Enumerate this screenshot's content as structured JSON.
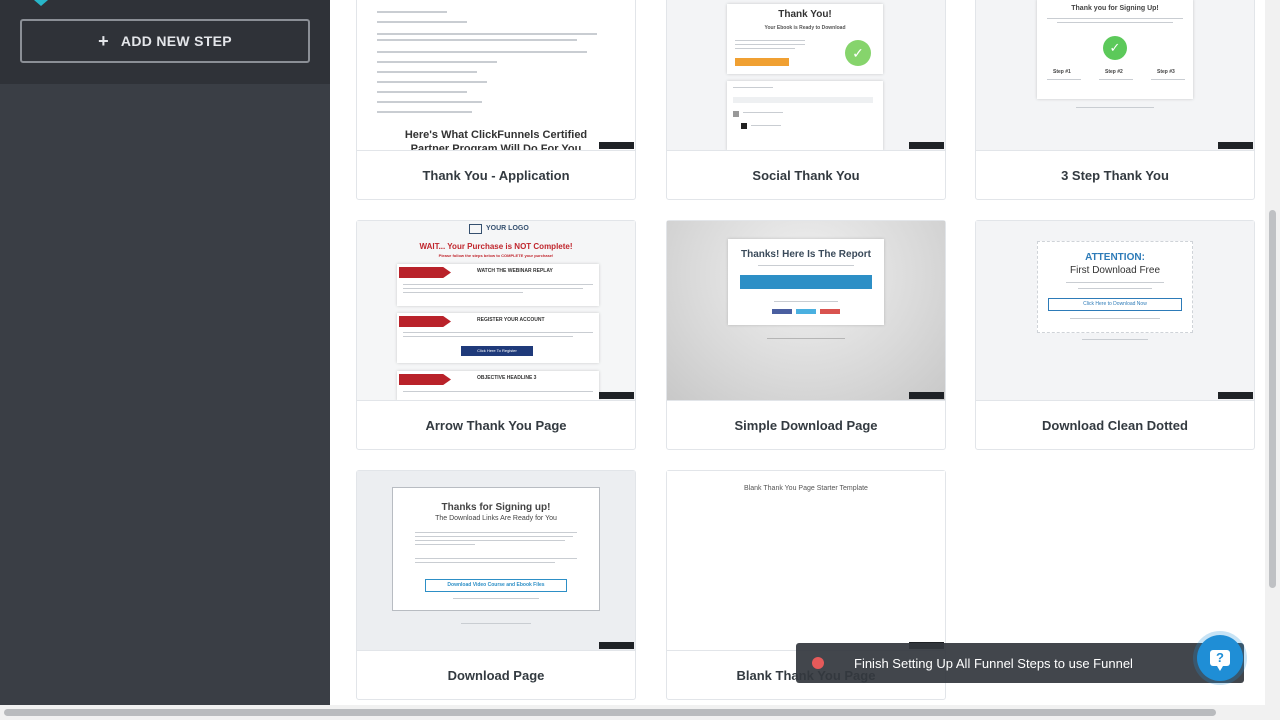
{
  "sidebar": {
    "add_step_label": "ADD NEW STEP",
    "add_step_icon": "plus-icon"
  },
  "templates": [
    {
      "name": "Thank You - Application",
      "preview": {
        "heading": "Here's What ClickFunnels Certified",
        "heading2": "Partner Program Will Do For You"
      }
    },
    {
      "name": "Social Thank You",
      "preview": {
        "title": "Thank You!",
        "subtitle": "Your Ebook is Ready to Download"
      }
    },
    {
      "name": "3 Step Thank You",
      "preview": {
        "title": "Thank you for Signing Up!",
        "steps": [
          "Step #1",
          "Step #2",
          "Step #3"
        ]
      }
    },
    {
      "name": "Arrow Thank You Page",
      "preview": {
        "logo": "YOUR LOGO",
        "headline": "WAIT... Your Purchase is NOT Complete!",
        "subhead": "Please follow the steps below to COMPLETE your purchase!",
        "rows": [
          "WATCH THE WEBINAR REPLAY",
          "REGISTER YOUR ACCOUNT",
          "OBJECTIVE HEADLINE 3"
        ],
        "button": "Click Here To Register"
      }
    },
    {
      "name": "Simple Download Page",
      "preview": {
        "title": "Thanks! Here Is The Report"
      }
    },
    {
      "name": "Download Clean Dotted",
      "preview": {
        "title": "ATTENTION:",
        "subtitle": "First Download Free",
        "button": "Click Here to Download Now"
      }
    },
    {
      "name": "Download Page",
      "preview": {
        "title": "Thanks for Signing up!",
        "subtitle": "The Download Links Are Ready for You",
        "button": "Download Video Course and Ebook Files"
      }
    },
    {
      "name": "Blank Thank You Page",
      "preview": {
        "caption": "Blank Thank You Page Starter Template"
      }
    }
  ],
  "toast": {
    "message": "Finish Setting Up All Funnel Steps to use Funnel"
  },
  "help": {
    "icon": "help-chat-icon",
    "glyph": "?"
  },
  "colors": {
    "sidebar": "#3a3e45",
    "accent": "#3f8fbd",
    "toast": "#34383e",
    "help": "#1f8ed6",
    "status_dot": "#e55a5a"
  }
}
